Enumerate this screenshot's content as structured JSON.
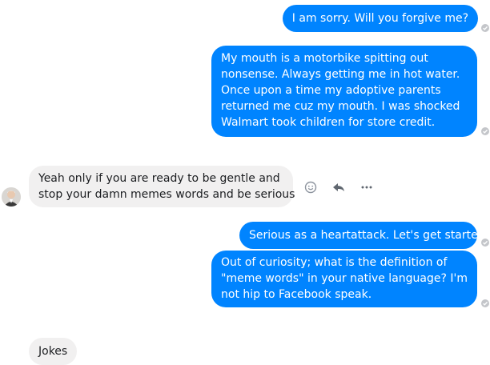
{
  "conversation": {
    "messages": [
      {
        "sender": "me",
        "text": "I am sorry. Will you forgive me?"
      },
      {
        "sender": "me",
        "lines": [
          "My mouth is a motorbike spitting out",
          "nonsense. Always getting me in hot water.",
          "Once upon a time my adoptive parents",
          "returned me cuz my mouth. I was shocked",
          "Walmart took children for store credit."
        ]
      },
      {
        "sender": "them",
        "lines": [
          "Yeah only if you are ready to  be gentle and",
          "stop your damn memes words and be serious"
        ]
      },
      {
        "sender": "me",
        "text": "Serious as a heartattack. Let's get started!"
      },
      {
        "sender": "me",
        "lines": [
          "Out of curiosity; what is the definition of",
          "\"meme words\" in your native language? I'm",
          "not hip to Facebook speak."
        ]
      },
      {
        "sender": "them",
        "text": "Jokes"
      }
    ]
  },
  "message_actions": [
    "smiley-icon",
    "reply-icon",
    "more-icon"
  ],
  "colors": {
    "outgoing_bubble": "#0084ff",
    "incoming_bubble": "#f1f0f0",
    "receipt": "#c4c6ca"
  }
}
